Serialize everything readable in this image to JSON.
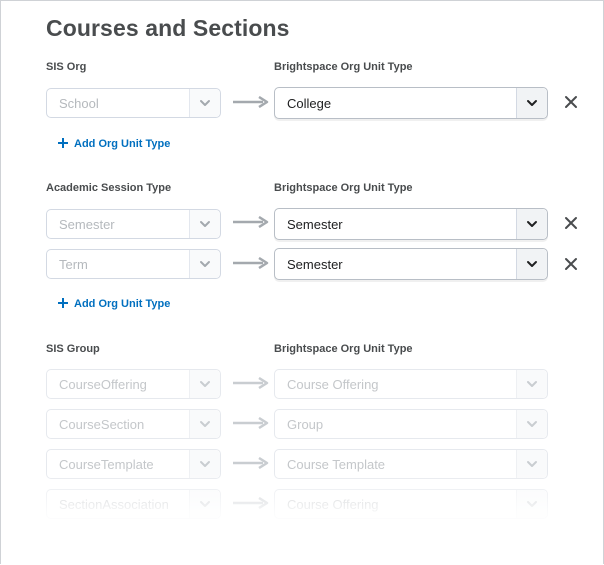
{
  "page": {
    "title": "Courses and Sections"
  },
  "sections": [
    {
      "source_label": "SIS Org",
      "target_label": "Brightspace Org Unit Type",
      "rows": [
        {
          "source": "School",
          "target": "College"
        }
      ],
      "add_label": "Add Org Unit Type"
    },
    {
      "source_label": "Academic Session Type",
      "target_label": "Brightspace Org Unit Type",
      "rows": [
        {
          "source": "Semester",
          "target": "Semester"
        },
        {
          "source": "Term",
          "target": "Semester"
        }
      ],
      "add_label": "Add Org Unit Type"
    },
    {
      "source_label": "SIS Group",
      "target_label": "Brightspace Org Unit Type",
      "rows": [
        {
          "source": "CourseOffering",
          "target": "Course Offering"
        },
        {
          "source": "CourseSection",
          "target": "Group"
        },
        {
          "source": "CourseTemplate",
          "target": "Course Template"
        },
        {
          "source": "SectionAssociation",
          "target": "Course Offering"
        }
      ]
    }
  ],
  "icons": {
    "dropdown": "chevron-down-icon",
    "mapping_arrow": "arrow-right-icon",
    "remove": "close-icon",
    "add": "plus-icon"
  },
  "colors": {
    "link": "#006fbf",
    "text": "#494c4e",
    "border": "#d3d9e3",
    "arrow": "#a4a9ae"
  }
}
